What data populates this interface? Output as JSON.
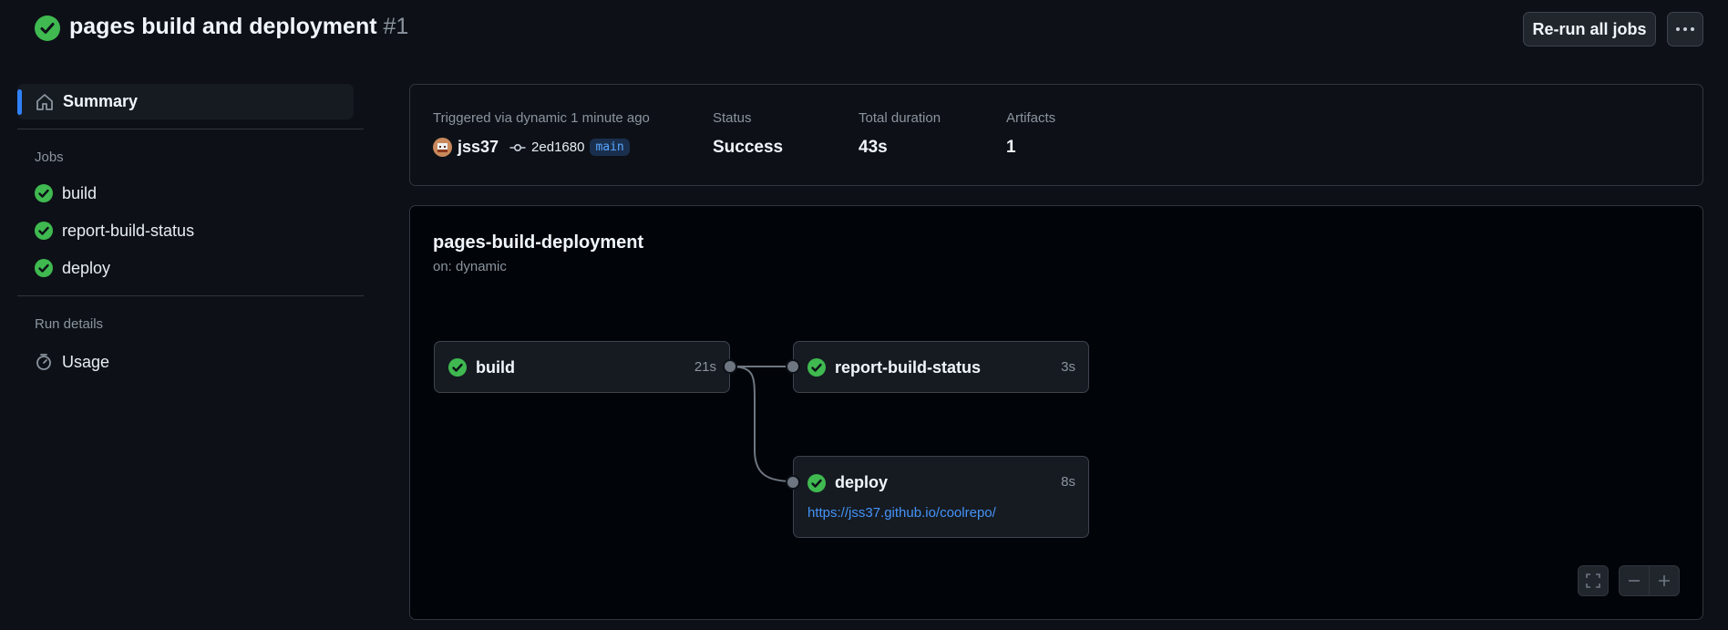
{
  "header": {
    "title": "pages build and deployment",
    "run_number": "#1",
    "rerun_label": "Re-run all jobs",
    "more_icon": "kebab-horizontal-icon"
  },
  "sidebar": {
    "summary_label": "Summary",
    "jobs_heading": "Jobs",
    "jobs": [
      {
        "label": "build",
        "status": "success"
      },
      {
        "label": "report-build-status",
        "status": "success"
      },
      {
        "label": "deploy",
        "status": "success"
      }
    ],
    "run_details_heading": "Run details",
    "usage_label": "Usage"
  },
  "summary": {
    "triggered_label": "Triggered via dynamic 1 minute ago",
    "actor": "jss37",
    "commit": "2ed1680",
    "branch": "main",
    "status_label": "Status",
    "status_value": "Success",
    "duration_label": "Total duration",
    "duration_value": "43s",
    "artifacts_label": "Artifacts",
    "artifacts_value": "1"
  },
  "graph": {
    "workflow_name": "pages-build-deployment",
    "trigger": "on: dynamic",
    "nodes": [
      {
        "name": "build",
        "duration": "21s"
      },
      {
        "name": "report-build-status",
        "duration": "3s"
      },
      {
        "name": "deploy",
        "duration": "8s",
        "link": "https://jss37.github.io/coolrepo/"
      }
    ]
  },
  "colors": {
    "success": "#3fb950",
    "accent": "#2f81f7",
    "link": "#4493f8",
    "background": "#0d1117"
  }
}
